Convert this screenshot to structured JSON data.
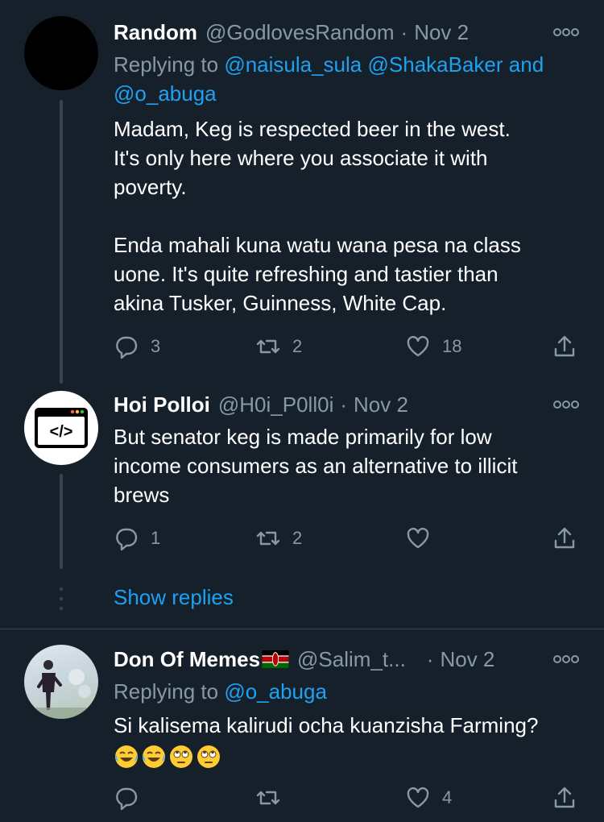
{
  "tweets": [
    {
      "name": "Random",
      "handle": "@GodlovesRandom",
      "separator": "·",
      "date": "Nov 2",
      "replying_label": "Replying to",
      "mentions": [
        "@naisula_sula",
        "@ShakaBaker",
        "@o_abuga"
      ],
      "mention_joiner": "and",
      "body_lines": [
        "Madam, Keg is respected beer in the west.",
        "It's only here where you associate it with",
        "poverty.",
        "",
        "Enda mahali kuna watu wana pesa na class",
        "uone. It's quite refreshing and tastier than",
        "akina Tusker, Guinness, White Cap."
      ],
      "replies": "3",
      "retweets": "2",
      "likes": "18",
      "avatar_color": "#000000"
    },
    {
      "name": "Hoi Polloi",
      "handle": "@H0i_P0ll0i",
      "separator": "·",
      "date": "Nov 2",
      "body_lines": [
        "But senator keg is made primarily for low",
        "income consumers as an alternative to illicit",
        "brews"
      ],
      "replies": "1",
      "retweets": "2",
      "likes": "",
      "avatar_icon": "code-window-icon",
      "avatar_text": "</>"
    },
    {
      "name": "Don Of Memes",
      "flag": "kenya-flag-icon",
      "handle": "@Salim_t...",
      "separator": "·",
      "date": "Nov 2",
      "replying_label": "Replying to",
      "mentions": [
        "@o_abuga"
      ],
      "body_lines": [
        "Si kalisema kalirudi ocha kuanzisha Farming?"
      ],
      "emojis": [
        "face-with-tears-of-joy-icon",
        "face-with-tears-of-joy-icon",
        "face-with-rolling-eyes-icon",
        "face-with-rolling-eyes-icon"
      ],
      "replies": "",
      "retweets": "",
      "likes": "4"
    }
  ],
  "show_replies_label": "Show replies",
  "colors": {
    "background": "#15202b",
    "text_primary": "#ffffff",
    "text_secondary": "#8899a6",
    "link": "#1da1f2",
    "divider": "#38444d"
  }
}
